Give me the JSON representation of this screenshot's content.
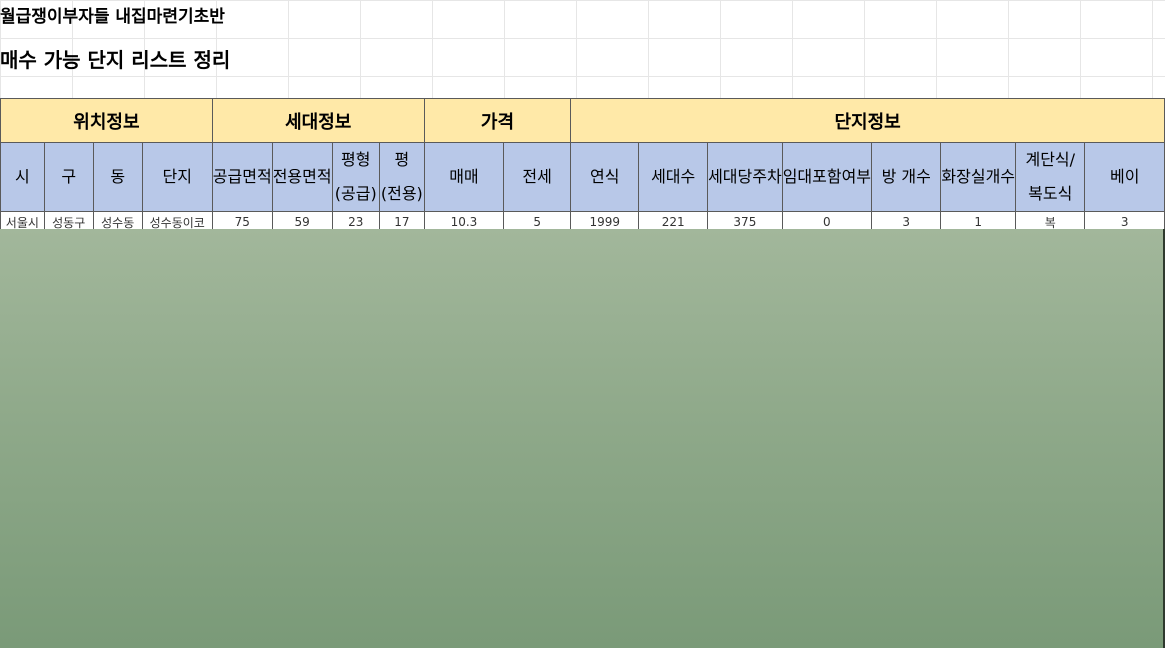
{
  "titles": {
    "line1": "월급쟁이부자들 내집마련기초반",
    "line2": "매수 가능 단지 리스트 정리"
  },
  "groups": [
    "위치정보",
    "세대정보",
    "가격",
    "단지정보"
  ],
  "subheaders": {
    "si": "시",
    "gu": "구",
    "dong": "동",
    "danji": "단지",
    "supply_area": "공급면적",
    "exclusive_area": "전용면적",
    "pyeong_supply": "평형(공급)",
    "pyeong_exclusive": "평(전용)",
    "sale": "매매",
    "jeonse": "전세",
    "year": "연식",
    "households": "세대수",
    "parking_per_household": "세대당주차",
    "rental_included": "임대포함여부",
    "rooms": "방 개수",
    "bathrooms": "화장실개수",
    "stair_type": "계단식/복도식",
    "bay": "베이"
  },
  "row1": {
    "si": "서울시",
    "gu": "성동구",
    "dong": "성수동",
    "danji": "성수동이코",
    "supply_area": "75",
    "exclusive_area": "59",
    "pyeong_supply": "23",
    "pyeong_exclusive": "17",
    "sale": "10.3",
    "jeonse": "5",
    "year": "1999",
    "households": "221",
    "parking_per_household": "375",
    "rental_included": "0",
    "rooms": "3",
    "bathrooms": "1",
    "stair_type": "복",
    "bay": "3"
  }
}
